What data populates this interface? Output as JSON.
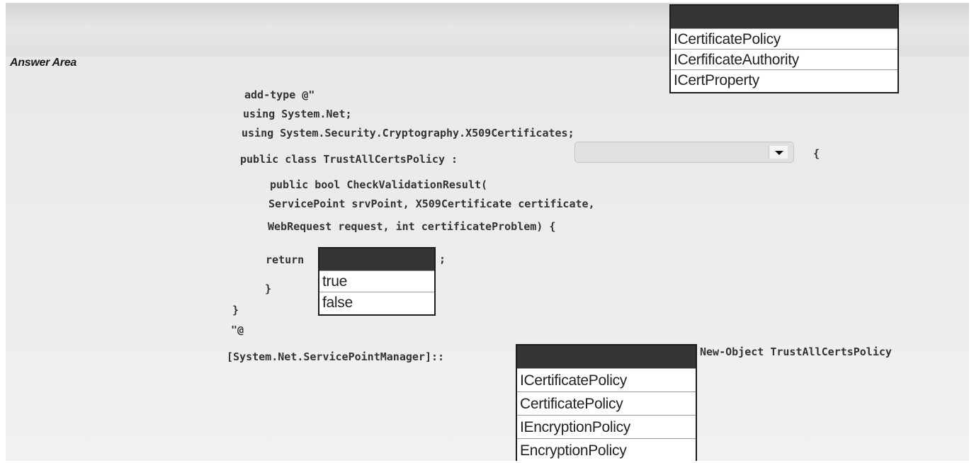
{
  "answer_area": {
    "title": "Answer Area"
  },
  "code": {
    "l1": "add-type @\"",
    "l2": "using System.Net;",
    "l3": "using System.Security.Cryptography.X509Certificates;",
    "l4": "public class TrustAllCertsPolicy :",
    "l4_brace": "{",
    "l5": "public bool CheckValidationResult(",
    "l6": "ServicePoint srvPoint, X509Certificate certificate,",
    "l7": "WebRequest request, int certificateProblem) {",
    "l8": "return",
    "l8_semicolon": ";",
    "l9": "}",
    "l10": "}",
    "l11": "\"@",
    "l12": "[System.Net.ServicePointManager]::",
    "l12_tail": "New-Object TrustAllCertsPolicy"
  },
  "interface_dropdown": {
    "options": [
      "ICertificatePolicy",
      "ICerfificateAuthority",
      "ICertProperty"
    ]
  },
  "return_dropdown": {
    "options": [
      "true",
      "false"
    ]
  },
  "policy_dropdown": {
    "options": [
      "ICertificatePolicy",
      "CertificatePolicy",
      "IEncryptionPolicy",
      "EncryptionPolicy"
    ]
  }
}
